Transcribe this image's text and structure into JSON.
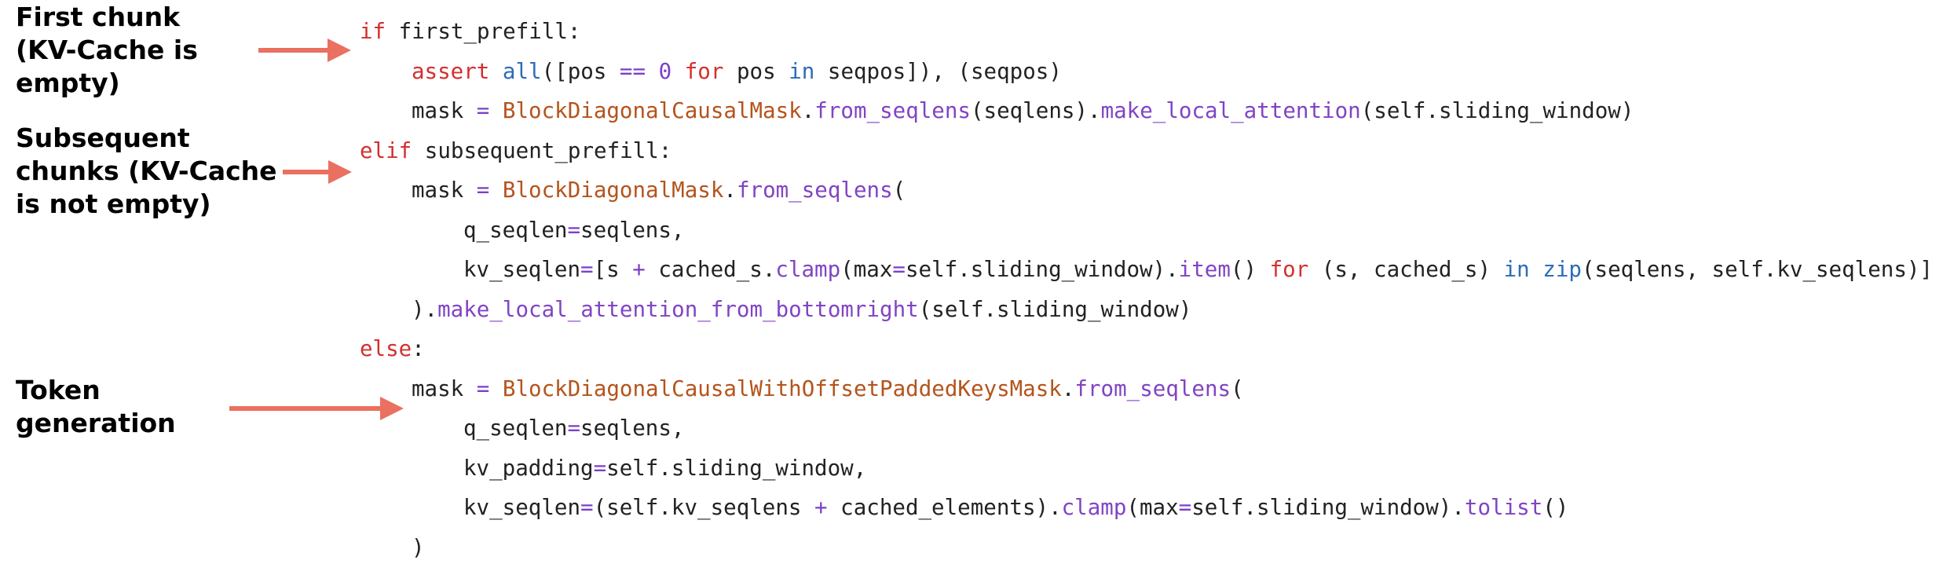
{
  "annotations": [
    {
      "id": "first",
      "lines": [
        "First chunk",
        "(KV-Cache is",
        "empty)"
      ]
    },
    {
      "id": "subsequent",
      "lines": [
        "Subsequent",
        "chunks (KV-Cache",
        "is not empty)"
      ]
    },
    {
      "id": "token",
      "lines": [
        "Token",
        "generation"
      ]
    }
  ],
  "code": {
    "lines": [
      [
        [
          "kw",
          "if"
        ],
        [
          "tx",
          " first_prefill:"
        ]
      ],
      [
        [
          "kw",
          "assert"
        ],
        [
          "tx",
          " "
        ],
        [
          "bi",
          "all"
        ],
        [
          "tx",
          "([pos "
        ],
        [
          "op",
          "=="
        ],
        [
          "tx",
          " "
        ],
        [
          "num",
          "0"
        ],
        [
          "tx",
          " "
        ],
        [
          "kw",
          "for"
        ],
        [
          "tx",
          " pos "
        ],
        [
          "bi",
          "in"
        ],
        [
          "tx",
          " seqpos]), (seqpos)"
        ]
      ],
      [
        [
          "tx",
          "mask "
        ],
        [
          "op",
          "="
        ],
        [
          "tx",
          " "
        ],
        [
          "cls",
          "BlockDiagonalCausalMask"
        ],
        [
          "tx",
          "."
        ],
        [
          "fn",
          "from_seqlens"
        ],
        [
          "tx",
          "(seqlens)."
        ],
        [
          "fn",
          "make_local_attention"
        ],
        [
          "tx",
          "(self.sliding_window)"
        ]
      ],
      [
        [
          "kw",
          "elif"
        ],
        [
          "tx",
          " subsequent_prefill:"
        ]
      ],
      [
        [
          "tx",
          "mask "
        ],
        [
          "op",
          "="
        ],
        [
          "tx",
          " "
        ],
        [
          "cls",
          "BlockDiagonalMask"
        ],
        [
          "tx",
          "."
        ],
        [
          "fn",
          "from_seqlens"
        ],
        [
          "tx",
          "("
        ]
      ],
      [
        [
          "tx",
          "q_seqlen"
        ],
        [
          "op",
          "="
        ],
        [
          "tx",
          "seqlens,"
        ]
      ],
      [
        [
          "tx",
          "kv_seqlen"
        ],
        [
          "op",
          "="
        ],
        [
          "tx",
          "[s "
        ],
        [
          "op",
          "+"
        ],
        [
          "tx",
          " cached_s."
        ],
        [
          "fn",
          "clamp"
        ],
        [
          "tx",
          "(max"
        ],
        [
          "op",
          "="
        ],
        [
          "tx",
          "self.sliding_window)."
        ],
        [
          "fn",
          "item"
        ],
        [
          "tx",
          "() "
        ],
        [
          "kw",
          "for"
        ],
        [
          "tx",
          " (s, cached_s) "
        ],
        [
          "bi",
          "in"
        ],
        [
          "tx",
          " "
        ],
        [
          "bi",
          "zip"
        ],
        [
          "tx",
          "(seqlens, self.kv_seqlens)]"
        ]
      ],
      [
        [
          "tx",
          ")."
        ],
        [
          "fn",
          "make_local_attention_from_bottomright"
        ],
        [
          "tx",
          "(self.sliding_window)"
        ]
      ],
      [
        [
          "kw",
          "else"
        ],
        [
          "tx",
          ":"
        ]
      ],
      [
        [
          "tx",
          "mask "
        ],
        [
          "op",
          "="
        ],
        [
          "tx",
          " "
        ],
        [
          "cls",
          "BlockDiagonalCausalWithOffsetPaddedKeysMask"
        ],
        [
          "tx",
          "."
        ],
        [
          "fn",
          "from_seqlens"
        ],
        [
          "tx",
          "("
        ]
      ],
      [
        [
          "tx",
          "q_seqlen"
        ],
        [
          "op",
          "="
        ],
        [
          "tx",
          "seqlens,"
        ]
      ],
      [
        [
          "tx",
          "kv_padding"
        ],
        [
          "op",
          "="
        ],
        [
          "tx",
          "self.sliding_window,"
        ]
      ],
      [
        [
          "tx",
          "kv_seqlen"
        ],
        [
          "op",
          "="
        ],
        [
          "tx",
          "(self.kv_seqlens "
        ],
        [
          "op",
          "+"
        ],
        [
          "tx",
          " cached_elements)."
        ],
        [
          "fn",
          "clamp"
        ],
        [
          "tx",
          "(max"
        ],
        [
          "op",
          "="
        ],
        [
          "tx",
          "self.sliding_window)."
        ],
        [
          "fn",
          "tolist"
        ],
        [
          "tx",
          "()"
        ]
      ],
      [
        [
          "tx",
          ")"
        ]
      ]
    ]
  }
}
